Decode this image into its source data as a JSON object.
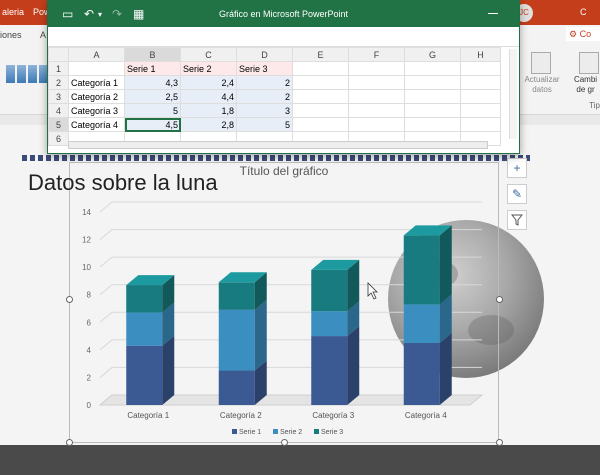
{
  "ppt": {
    "top_fragments": [
      "aleria",
      "Pow",
      "C"
    ],
    "user_initials": "JC",
    "tabs": [
      "iones",
      "A"
    ],
    "design_tab": "Co",
    "refresh_button": "Actualizar datos",
    "change_type_button": "Cambi de gr",
    "group_label": "Tip"
  },
  "slide": {
    "title": "Datos sobre la luna"
  },
  "excel": {
    "window_title": "Gráfico en Microsoft PowerPoint",
    "columns": [
      "A",
      "B",
      "C",
      "D",
      "E",
      "F",
      "G",
      "H"
    ],
    "rows": [
      {
        "n": "1",
        "cells": [
          "",
          "Serie 1",
          "Serie 2",
          "Serie 3"
        ]
      },
      {
        "n": "2",
        "cells": [
          "Categoría 1",
          "4,3",
          "2,4",
          "2"
        ]
      },
      {
        "n": "3",
        "cells": [
          "Categoría 2",
          "2,5",
          "4,4",
          "2"
        ]
      },
      {
        "n": "4",
        "cells": [
          "Categoría 3",
          "5",
          "1,8",
          "3"
        ]
      },
      {
        "n": "5",
        "cells": [
          "Categoría 4",
          "4,5",
          "2,8",
          "5"
        ]
      },
      {
        "n": "6",
        "cells": [
          "",
          "",
          "",
          ""
        ]
      }
    ]
  },
  "colors": {
    "serie1": "#3b5a93",
    "serie2": "#3a8fc0",
    "serie3": "#177b7f",
    "excel_green": "#217346",
    "ppt_red": "#c43e1c"
  },
  "chart_data": {
    "type": "bar",
    "stacked": true,
    "style": "3d",
    "title": "Título del gráfico",
    "categories": [
      "Categoría 1",
      "Categoría 2",
      "Categoría 3",
      "Categoría 4"
    ],
    "series": [
      {
        "name": "Serie 1",
        "values": [
          4.3,
          2.5,
          5,
          4.5
        ]
      },
      {
        "name": "Serie 2",
        "values": [
          2.4,
          4.4,
          1.8,
          2.8
        ]
      },
      {
        "name": "Serie 3",
        "values": [
          2,
          2,
          3,
          5
        ]
      }
    ],
    "ylim": [
      0,
      14
    ],
    "yticks": [
      0,
      2,
      4,
      6,
      8,
      10,
      12,
      14
    ],
    "legend_position": "bottom",
    "grid": true
  }
}
